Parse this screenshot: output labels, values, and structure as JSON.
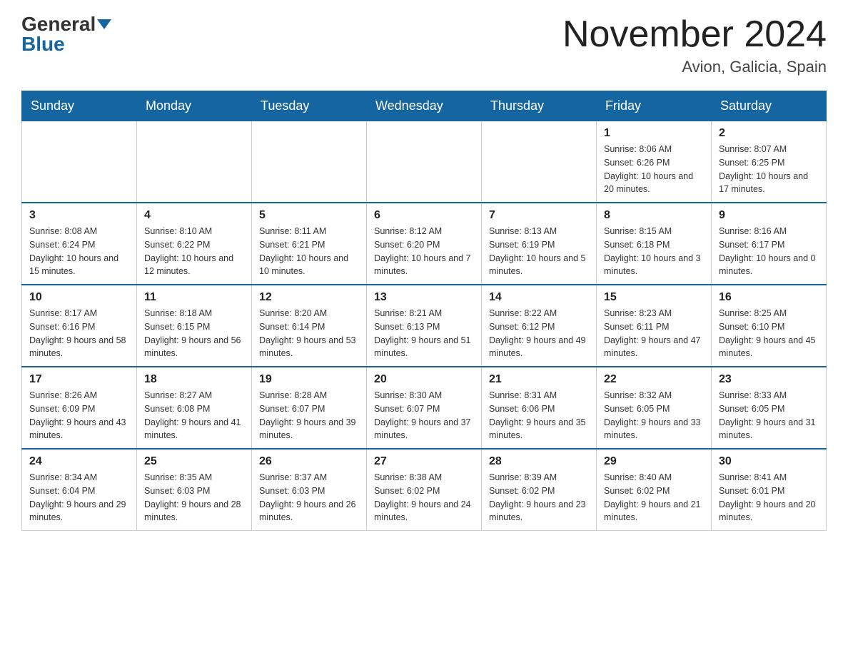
{
  "header": {
    "logo_general": "General",
    "logo_blue": "Blue",
    "month_title": "November 2024",
    "location": "Avion, Galicia, Spain"
  },
  "weekdays": [
    "Sunday",
    "Monday",
    "Tuesday",
    "Wednesday",
    "Thursday",
    "Friday",
    "Saturday"
  ],
  "weeks": [
    [
      {
        "day": "",
        "sunrise": "",
        "sunset": "",
        "daylight": ""
      },
      {
        "day": "",
        "sunrise": "",
        "sunset": "",
        "daylight": ""
      },
      {
        "day": "",
        "sunrise": "",
        "sunset": "",
        "daylight": ""
      },
      {
        "day": "",
        "sunrise": "",
        "sunset": "",
        "daylight": ""
      },
      {
        "day": "",
        "sunrise": "",
        "sunset": "",
        "daylight": ""
      },
      {
        "day": "1",
        "sunrise": "Sunrise: 8:06 AM",
        "sunset": "Sunset: 6:26 PM",
        "daylight": "Daylight: 10 hours and 20 minutes."
      },
      {
        "day": "2",
        "sunrise": "Sunrise: 8:07 AM",
        "sunset": "Sunset: 6:25 PM",
        "daylight": "Daylight: 10 hours and 17 minutes."
      }
    ],
    [
      {
        "day": "3",
        "sunrise": "Sunrise: 8:08 AM",
        "sunset": "Sunset: 6:24 PM",
        "daylight": "Daylight: 10 hours and 15 minutes."
      },
      {
        "day": "4",
        "sunrise": "Sunrise: 8:10 AM",
        "sunset": "Sunset: 6:22 PM",
        "daylight": "Daylight: 10 hours and 12 minutes."
      },
      {
        "day": "5",
        "sunrise": "Sunrise: 8:11 AM",
        "sunset": "Sunset: 6:21 PM",
        "daylight": "Daylight: 10 hours and 10 minutes."
      },
      {
        "day": "6",
        "sunrise": "Sunrise: 8:12 AM",
        "sunset": "Sunset: 6:20 PM",
        "daylight": "Daylight: 10 hours and 7 minutes."
      },
      {
        "day": "7",
        "sunrise": "Sunrise: 8:13 AM",
        "sunset": "Sunset: 6:19 PM",
        "daylight": "Daylight: 10 hours and 5 minutes."
      },
      {
        "day": "8",
        "sunrise": "Sunrise: 8:15 AM",
        "sunset": "Sunset: 6:18 PM",
        "daylight": "Daylight: 10 hours and 3 minutes."
      },
      {
        "day": "9",
        "sunrise": "Sunrise: 8:16 AM",
        "sunset": "Sunset: 6:17 PM",
        "daylight": "Daylight: 10 hours and 0 minutes."
      }
    ],
    [
      {
        "day": "10",
        "sunrise": "Sunrise: 8:17 AM",
        "sunset": "Sunset: 6:16 PM",
        "daylight": "Daylight: 9 hours and 58 minutes."
      },
      {
        "day": "11",
        "sunrise": "Sunrise: 8:18 AM",
        "sunset": "Sunset: 6:15 PM",
        "daylight": "Daylight: 9 hours and 56 minutes."
      },
      {
        "day": "12",
        "sunrise": "Sunrise: 8:20 AM",
        "sunset": "Sunset: 6:14 PM",
        "daylight": "Daylight: 9 hours and 53 minutes."
      },
      {
        "day": "13",
        "sunrise": "Sunrise: 8:21 AM",
        "sunset": "Sunset: 6:13 PM",
        "daylight": "Daylight: 9 hours and 51 minutes."
      },
      {
        "day": "14",
        "sunrise": "Sunrise: 8:22 AM",
        "sunset": "Sunset: 6:12 PM",
        "daylight": "Daylight: 9 hours and 49 minutes."
      },
      {
        "day": "15",
        "sunrise": "Sunrise: 8:23 AM",
        "sunset": "Sunset: 6:11 PM",
        "daylight": "Daylight: 9 hours and 47 minutes."
      },
      {
        "day": "16",
        "sunrise": "Sunrise: 8:25 AM",
        "sunset": "Sunset: 6:10 PM",
        "daylight": "Daylight: 9 hours and 45 minutes."
      }
    ],
    [
      {
        "day": "17",
        "sunrise": "Sunrise: 8:26 AM",
        "sunset": "Sunset: 6:09 PM",
        "daylight": "Daylight: 9 hours and 43 minutes."
      },
      {
        "day": "18",
        "sunrise": "Sunrise: 8:27 AM",
        "sunset": "Sunset: 6:08 PM",
        "daylight": "Daylight: 9 hours and 41 minutes."
      },
      {
        "day": "19",
        "sunrise": "Sunrise: 8:28 AM",
        "sunset": "Sunset: 6:07 PM",
        "daylight": "Daylight: 9 hours and 39 minutes."
      },
      {
        "day": "20",
        "sunrise": "Sunrise: 8:30 AM",
        "sunset": "Sunset: 6:07 PM",
        "daylight": "Daylight: 9 hours and 37 minutes."
      },
      {
        "day": "21",
        "sunrise": "Sunrise: 8:31 AM",
        "sunset": "Sunset: 6:06 PM",
        "daylight": "Daylight: 9 hours and 35 minutes."
      },
      {
        "day": "22",
        "sunrise": "Sunrise: 8:32 AM",
        "sunset": "Sunset: 6:05 PM",
        "daylight": "Daylight: 9 hours and 33 minutes."
      },
      {
        "day": "23",
        "sunrise": "Sunrise: 8:33 AM",
        "sunset": "Sunset: 6:05 PM",
        "daylight": "Daylight: 9 hours and 31 minutes."
      }
    ],
    [
      {
        "day": "24",
        "sunrise": "Sunrise: 8:34 AM",
        "sunset": "Sunset: 6:04 PM",
        "daylight": "Daylight: 9 hours and 29 minutes."
      },
      {
        "day": "25",
        "sunrise": "Sunrise: 8:35 AM",
        "sunset": "Sunset: 6:03 PM",
        "daylight": "Daylight: 9 hours and 28 minutes."
      },
      {
        "day": "26",
        "sunrise": "Sunrise: 8:37 AM",
        "sunset": "Sunset: 6:03 PM",
        "daylight": "Daylight: 9 hours and 26 minutes."
      },
      {
        "day": "27",
        "sunrise": "Sunrise: 8:38 AM",
        "sunset": "Sunset: 6:02 PM",
        "daylight": "Daylight: 9 hours and 24 minutes."
      },
      {
        "day": "28",
        "sunrise": "Sunrise: 8:39 AM",
        "sunset": "Sunset: 6:02 PM",
        "daylight": "Daylight: 9 hours and 23 minutes."
      },
      {
        "day": "29",
        "sunrise": "Sunrise: 8:40 AM",
        "sunset": "Sunset: 6:02 PM",
        "daylight": "Daylight: 9 hours and 21 minutes."
      },
      {
        "day": "30",
        "sunrise": "Sunrise: 8:41 AM",
        "sunset": "Sunset: 6:01 PM",
        "daylight": "Daylight: 9 hours and 20 minutes."
      }
    ]
  ]
}
